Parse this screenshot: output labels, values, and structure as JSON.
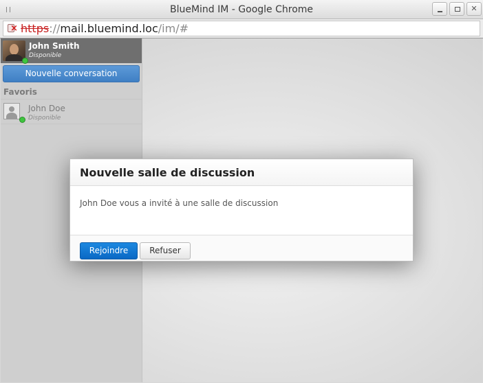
{
  "window": {
    "title": "BlueMind IM - Google Chrome"
  },
  "address_bar": {
    "scheme": "https",
    "separator": "://",
    "host": "mail.bluemind.loc",
    "path": "/im/#"
  },
  "sidebar": {
    "current_user": {
      "name": "John Smith",
      "status": "Disponible"
    },
    "new_conversation_label": "Nouvelle conversation",
    "favorites_heading": "Favoris",
    "contacts": [
      {
        "name": "John Doe",
        "status": "Disponible"
      }
    ]
  },
  "dialog": {
    "title": "Nouvelle salle de discussion",
    "message": "John Doe vous a invité à une salle de discussion",
    "join_label": "Rejoindre",
    "decline_label": "Refuser"
  },
  "colors": {
    "primary_button": "#0a68c4",
    "presence_available": "#3fc43f",
    "insecure_scheme": "#c72020"
  }
}
